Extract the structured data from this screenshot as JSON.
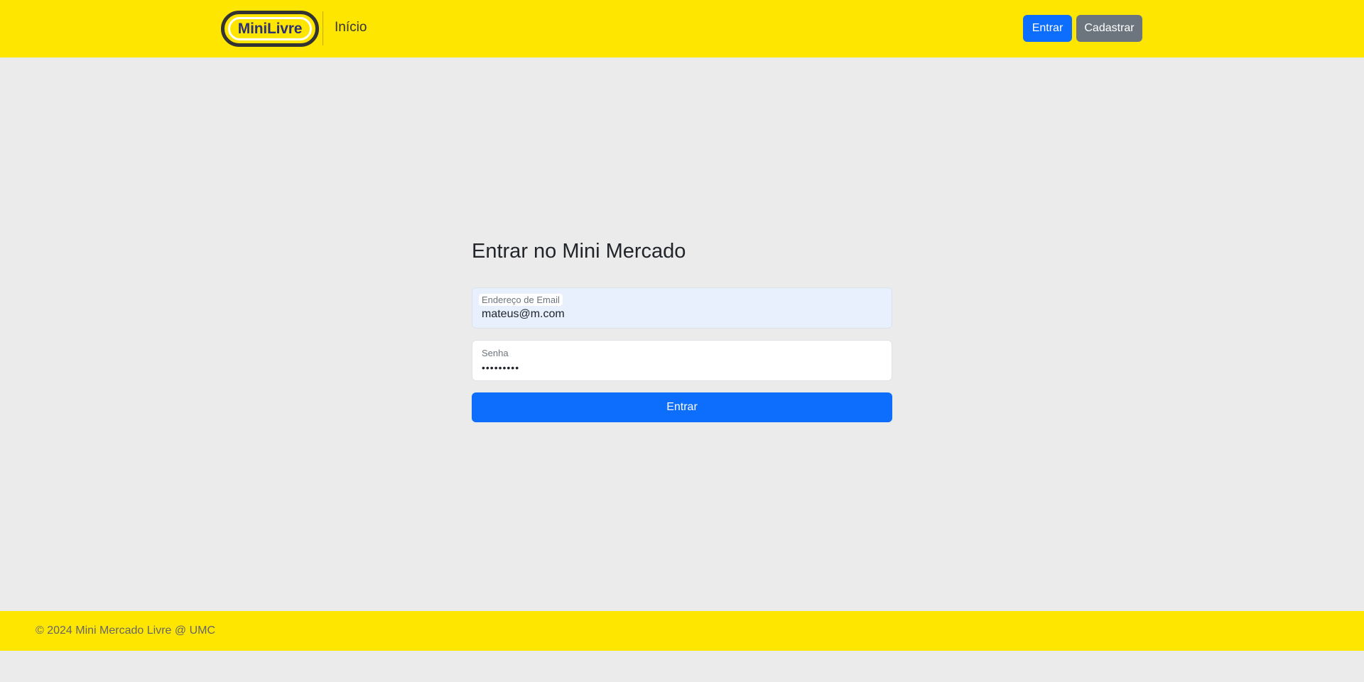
{
  "header": {
    "brand": "MiniLivre",
    "nav_home": "Início",
    "login_label": "Entrar",
    "signup_label": "Cadastrar"
  },
  "login_form": {
    "title": "Entrar no Mini Mercado",
    "email_label": "Endereço de Email",
    "email_value": "mateus@m.com",
    "password_label": "Senha",
    "password_value": "•••••••••",
    "submit_label": "Entrar"
  },
  "footer": {
    "text": "© 2024 Mini Mercado Livre @ UMC"
  },
  "colors": {
    "header_bg": "#ffe600",
    "page_bg": "#ebebeb",
    "primary": "#0d6efd",
    "secondary": "#6c757d",
    "autofill_bg": "#e8f0fe"
  }
}
